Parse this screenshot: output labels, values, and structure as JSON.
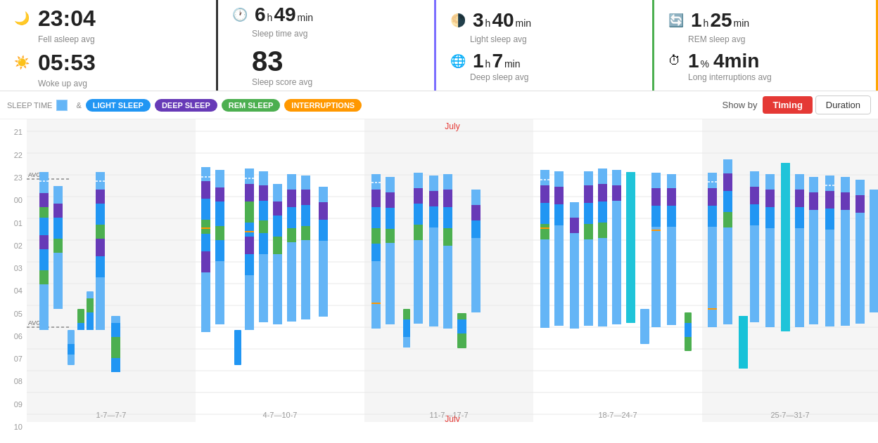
{
  "stats": {
    "fell_asleep": {
      "time": "23:04",
      "label": "Fell asleep avg",
      "icon": "moon"
    },
    "woke_up": {
      "time": "05:53",
      "label": "Woke up avg",
      "icon": "sun"
    },
    "sleep_time": {
      "hours": "6",
      "mins": "49",
      "unit_h": "h",
      "unit_m": "min",
      "label": "Sleep time avg"
    },
    "sleep_score": {
      "value": "83",
      "label": "Sleep score avg"
    },
    "light_sleep": {
      "hours": "3",
      "mins": "40",
      "unit_h": "h",
      "unit_m": "min",
      "label": "Light sleep avg"
    },
    "deep_sleep": {
      "hours": "1",
      "mins": "7",
      "unit_h": "h",
      "unit_m": "min",
      "label": "Deep sleep avg"
    },
    "rem_sleep": {
      "hours": "1",
      "mins": "25",
      "unit_h": "h",
      "unit_m": "min",
      "label": "REM sleep avg"
    },
    "long_interruptions": {
      "pct": "1",
      "mins": "4min",
      "label": "Long interruptions avg"
    }
  },
  "legend": {
    "sleep_time_label": "SLEEP TIME",
    "and_label": "&",
    "light_sleep": "LIGHT SLEEP",
    "deep_sleep": "DEEP SLEEP",
    "rem_sleep": "REM SLEEP",
    "interruptions": "INTERRUPTIONS"
  },
  "controls": {
    "show_by_label": "Show by",
    "timing_label": "Timing",
    "duration_label": "Duration"
  },
  "chart": {
    "y_labels": [
      "21",
      "22",
      "23",
      "00",
      "01",
      "02",
      "03",
      "04",
      "05",
      "06",
      "07",
      "08",
      "09",
      "10"
    ],
    "x_labels": [
      "1-7—7-7",
      "4-7—10-7",
      "11-7—17-7",
      "18-7—24-7",
      "25-7—31-7"
    ],
    "july_labels": [
      "July",
      "July"
    ],
    "avg_fell_asleep": "AVG",
    "avg_woke_up": "AVG"
  }
}
